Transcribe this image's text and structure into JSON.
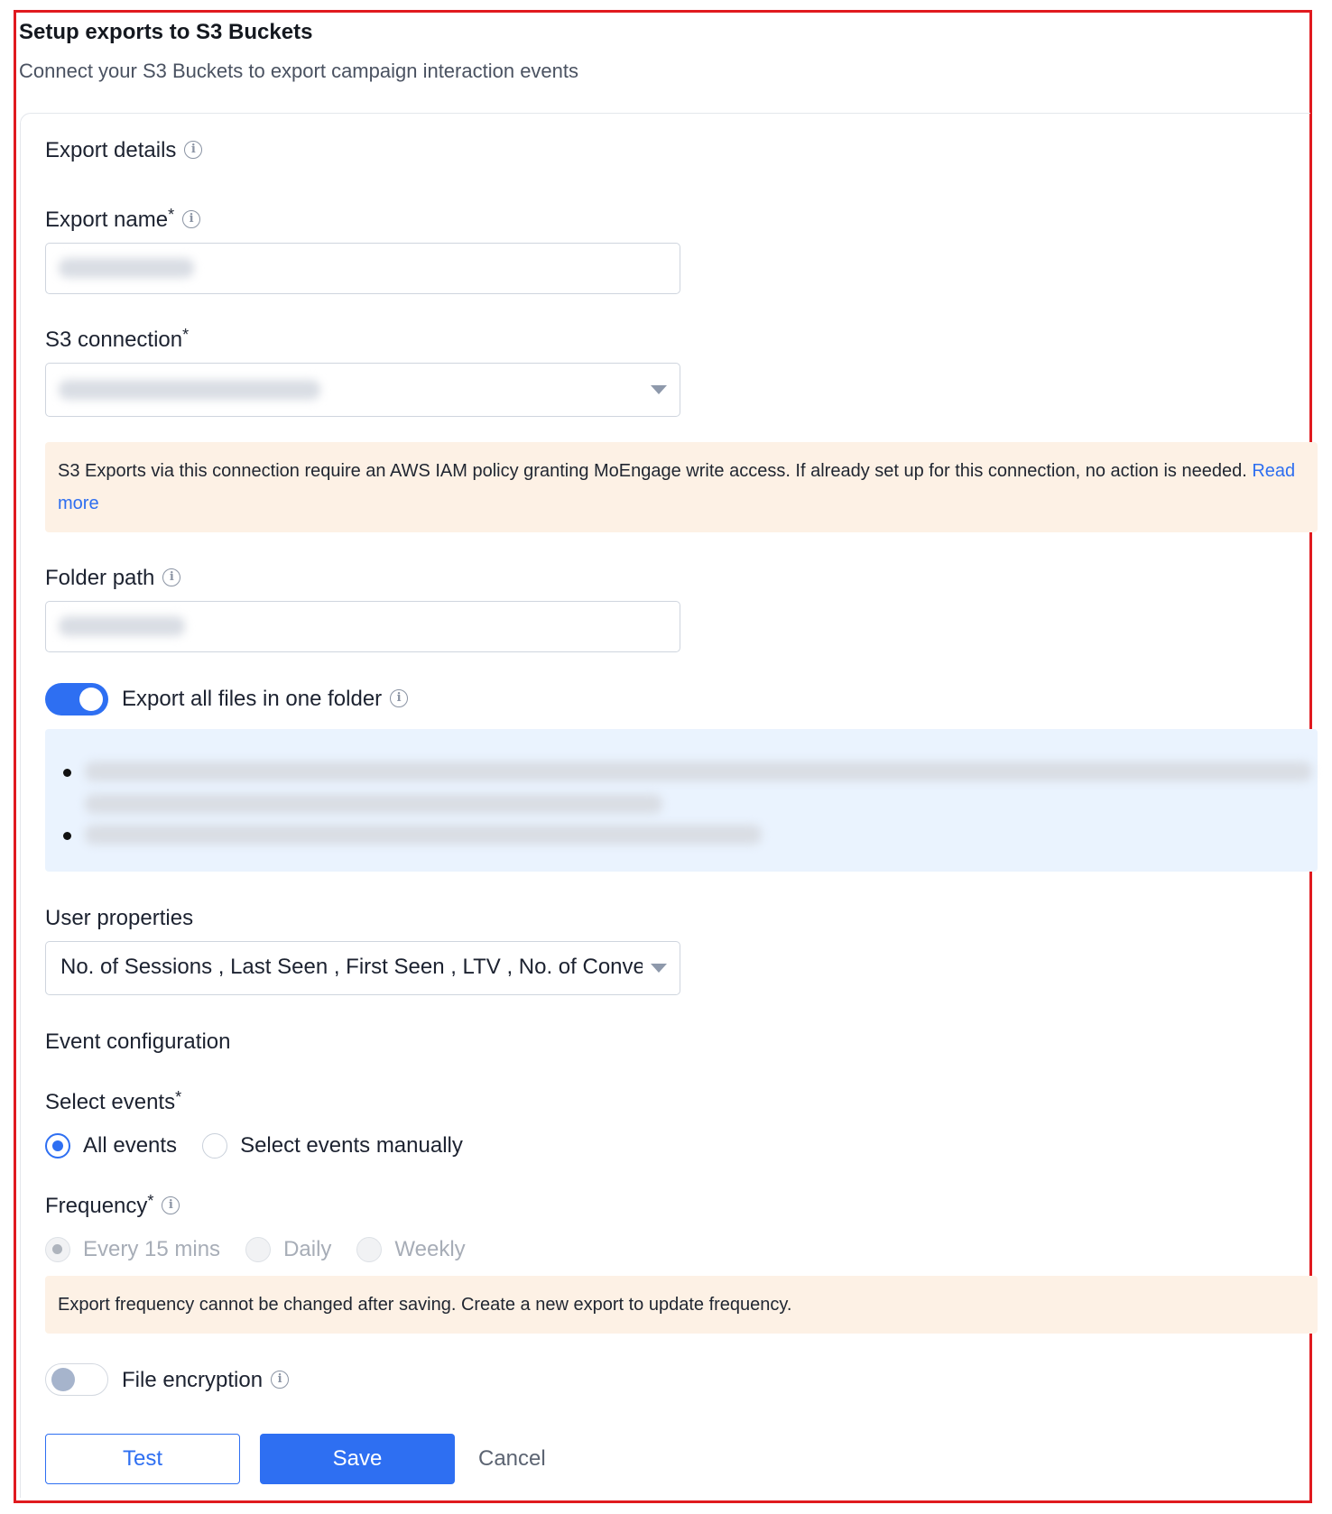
{
  "header": {
    "title": "Setup exports to S3 Buckets",
    "subtitle": "Connect your S3 Buckets to export campaign interaction events"
  },
  "export_details": {
    "section_title": "Export details",
    "export_name_label": "Export name",
    "s3_connection_label": "S3 connection",
    "iam_warning_text": "S3 Exports via this connection require an AWS IAM policy granting MoEngage write access. If already set up for this connection, no action is needed.",
    "read_more_link": "Read more",
    "folder_path_label": "Folder path",
    "export_all_toggle_label": "Export all files in one folder",
    "export_all_toggle_on": true,
    "user_properties_label": "User properties",
    "user_properties_value": "No. of Sessions , Last Seen , First Seen , LTV , No. of Conversions"
  },
  "event_configuration": {
    "section_title": "Event configuration",
    "select_events_label": "Select events",
    "select_events_options": [
      "All events",
      "Select events manually"
    ],
    "frequency_label": "Frequency",
    "frequency_options": [
      "Every 15 mins",
      "Daily",
      "Weekly"
    ],
    "frequency_warning": "Export frequency cannot be changed after saving. Create a new export to update frequency.",
    "file_encryption_label": "File encryption",
    "file_encryption_on": false
  },
  "actions": {
    "test": "Test",
    "save": "Save",
    "cancel": "Cancel"
  },
  "colors": {
    "primary": "#2e6ff2",
    "warning_bg": "#fdf1e5",
    "info_bg": "#eaf3fe",
    "frame": "#e01a1f"
  }
}
